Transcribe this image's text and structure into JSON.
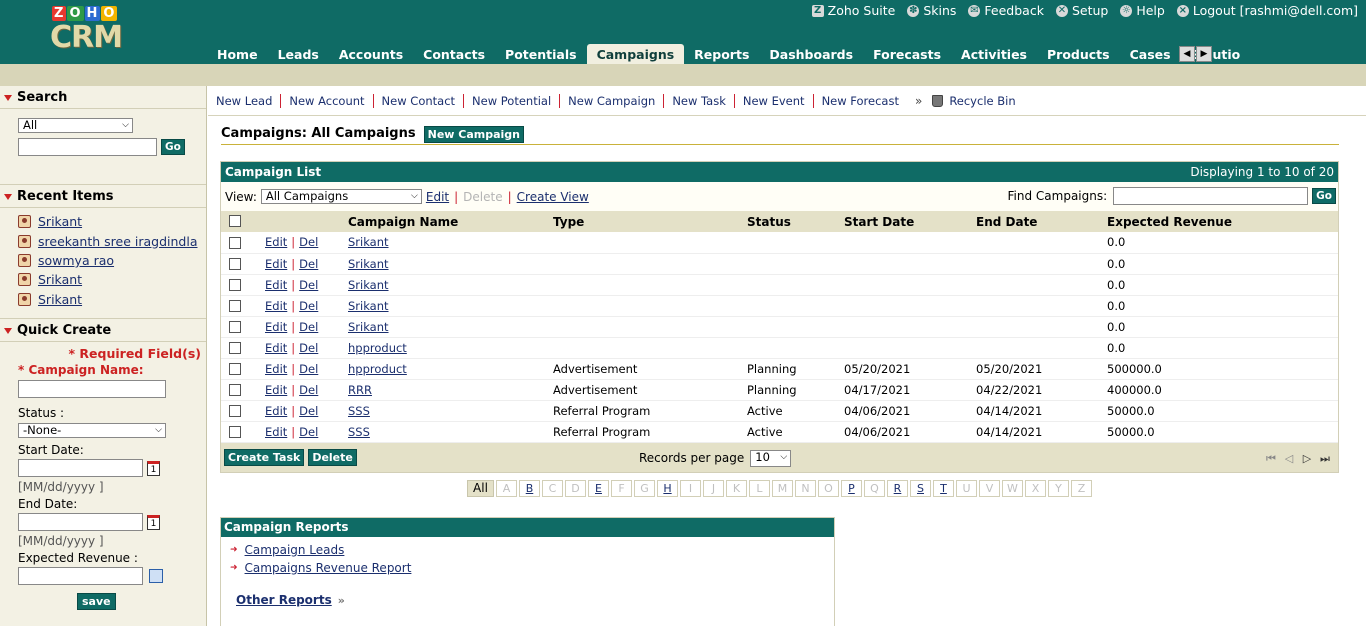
{
  "header": {
    "logo_top": "ZOHO",
    "logo_main": "CRM",
    "top_links": [
      {
        "label": "Zoho Suite",
        "icon": "zoho-suite-icon",
        "glyph": "Z"
      },
      {
        "label": "Skins",
        "icon": "skins-icon",
        "glyph": "✽"
      },
      {
        "label": "Feedback",
        "icon": "mail-icon",
        "glyph": "✉"
      },
      {
        "label": "Setup",
        "icon": "wrench-icon",
        "glyph": "✕"
      },
      {
        "label": "Help",
        "icon": "bulb-icon",
        "glyph": "☼"
      },
      {
        "label": "Logout [rashmi@dell.com]",
        "icon": "logout-icon",
        "glyph": "×"
      }
    ],
    "tabs": [
      "Home",
      "Leads",
      "Accounts",
      "Contacts",
      "Potentials",
      "Campaigns",
      "Reports",
      "Dashboards",
      "Forecasts",
      "Activities",
      "Products",
      "Cases",
      "Solutio"
    ],
    "active_tab": "Campaigns",
    "tab_scroll_left": "◀",
    "tab_scroll_right": "▶"
  },
  "quick_create_bar": {
    "links": [
      "New Lead",
      "New Account",
      "New Contact",
      "New Potential",
      "New Campaign",
      "New Task",
      "New Event",
      "New Forecast"
    ],
    "more": "»",
    "recycle_bin": "Recycle Bin"
  },
  "sidebar": {
    "search": {
      "title": "Search",
      "scope": "All",
      "go": "Go"
    },
    "recent": {
      "title": "Recent Items",
      "items": [
        "Srikant",
        "sreekanth sree iragdindla",
        "sowmya rao",
        "Srikant",
        "Srikant"
      ]
    },
    "quick_create": {
      "title": "Quick Create",
      "required_note": "* Required Field(s)",
      "campaign_name_label": "* Campaign Name:",
      "status_label": "Status :",
      "status_value": "-None-",
      "start_date_label": "Start Date:",
      "end_date_label": "End Date:",
      "date_hint": "[MM/dd/yyyy ]",
      "calendar_glyph": "1",
      "expected_revenue_label": "Expected Revenue :",
      "save": "save"
    }
  },
  "main": {
    "page_title": "Campaigns: All Campaigns",
    "new_button": "New Campaign",
    "list": {
      "title": "Campaign List",
      "displaying": "Displaying 1 to 10 of 20",
      "view_label": "View:",
      "view_value": "All Campaigns",
      "edit": "Edit",
      "delete": "Delete",
      "create_view": "Create View",
      "find_label": "Find Campaigns:",
      "find_go": "Go",
      "columns": [
        "Campaign Name",
        "Type",
        "Status",
        "Start Date",
        "End Date",
        "Expected Revenue"
      ],
      "row_edit": "Edit",
      "row_del": "Del",
      "rows": [
        {
          "name": "Srikant",
          "type": "",
          "status": "",
          "start": "",
          "end": "",
          "revenue": "0.0"
        },
        {
          "name": "Srikant",
          "type": "",
          "status": "",
          "start": "",
          "end": "",
          "revenue": "0.0"
        },
        {
          "name": "Srikant",
          "type": "",
          "status": "",
          "start": "",
          "end": "",
          "revenue": "0.0"
        },
        {
          "name": "Srikant",
          "type": "",
          "status": "",
          "start": "",
          "end": "",
          "revenue": "0.0"
        },
        {
          "name": "Srikant",
          "type": "",
          "status": "",
          "start": "",
          "end": "",
          "revenue": "0.0"
        },
        {
          "name": "hpproduct",
          "type": "",
          "status": "",
          "start": "",
          "end": "",
          "revenue": "0.0"
        },
        {
          "name": "hpproduct",
          "type": "Advertisement",
          "status": "Planning",
          "start": "05/20/2021",
          "end": "05/20/2021",
          "revenue": "500000.0"
        },
        {
          "name": "RRR",
          "type": "Advertisement",
          "status": "Planning",
          "start": "04/17/2021",
          "end": "04/22/2021",
          "revenue": "400000.0"
        },
        {
          "name": "SSS",
          "type": "Referral Program",
          "status": "Active",
          "start": "04/06/2021",
          "end": "04/14/2021",
          "revenue": "50000.0"
        },
        {
          "name": "SSS",
          "type": "Referral Program",
          "status": "Active",
          "start": "04/06/2021",
          "end": "04/14/2021",
          "revenue": "50000.0"
        }
      ],
      "create_task": "Create Task",
      "delete_button": "Delete",
      "records_per_page_label": "Records per page",
      "records_per_page": "10",
      "nav": [
        "⏮",
        "◁",
        "▷",
        "⏭"
      ]
    },
    "alphabet": {
      "all": "All",
      "letters": [
        "A",
        "B",
        "C",
        "D",
        "E",
        "F",
        "G",
        "H",
        "I",
        "J",
        "K",
        "L",
        "M",
        "N",
        "O",
        "P",
        "Q",
        "R",
        "S",
        "T",
        "U",
        "V",
        "W",
        "X",
        "Y",
        "Z"
      ],
      "active_letters": [
        "B",
        "E",
        "H",
        "P",
        "R",
        "S",
        "T"
      ]
    },
    "reports": {
      "title": "Campaign Reports",
      "links": [
        "Campaign Leads",
        "Campaigns Revenue Report"
      ],
      "other": "Other Reports",
      "other_glyph": "»"
    }
  },
  "colors": {
    "brand_teal": "#0f6b65",
    "header_band": "#d8d5b8",
    "sidebar_bg": "#f3f1e4",
    "table_header": "#e4e1c8",
    "link": "#1b2f6e",
    "separator_red": "#cc2233"
  }
}
